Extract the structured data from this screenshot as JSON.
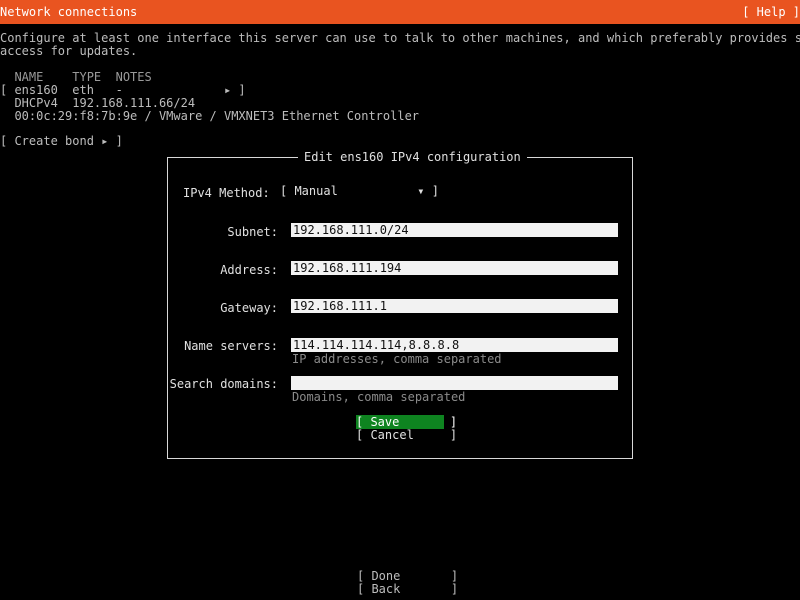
{
  "titlebar": {
    "title": "Network connections",
    "help": "[ Help ]"
  },
  "intro": {
    "line1": "Configure at least one interface this server can use to talk to other machines, and which preferably provides sufficient",
    "line2": "access for updates."
  },
  "interfaces": {
    "header": "  NAME    TYPE  NOTES",
    "row": "[ ens160  eth   -              ▸ ]",
    "dhcp": "  DHCPv4  192.168.111.66/24",
    "hw": "  00:0c:29:f8:7b:9e / VMware / VMXNET3 Ethernet Controller"
  },
  "create_bond": "[ Create bond ▸ ]",
  "dialog": {
    "title": "Edit ens160 IPv4 configuration",
    "method_label": "IPv4 Method:",
    "method_value": "[ Manual           ▾ ]",
    "fields": [
      {
        "label": "Subnet:",
        "value": "192.168.111.0/24",
        "hint": ""
      },
      {
        "label": "Address:",
        "value": "192.168.111.194",
        "hint": ""
      },
      {
        "label": "Gateway:",
        "value": "192.168.111.1",
        "hint": ""
      },
      {
        "label": "Name servers:",
        "value": "114.114.114.114,8.8.8.8",
        "hint": "IP addresses, comma separated"
      },
      {
        "label": "Search domains:",
        "value": "",
        "hint": "Domains, comma separated"
      }
    ],
    "save_label": "[ Save       ]",
    "cancel_label": "[ Cancel     ]"
  },
  "footer": {
    "done_label": "[ Done       ]",
    "back_label": "[ Back       ]"
  },
  "colors": {
    "titlebar": "#e95420",
    "focus_button": "#0e8420",
    "input_bg": "#f2f2f2",
    "background": "#000000"
  }
}
